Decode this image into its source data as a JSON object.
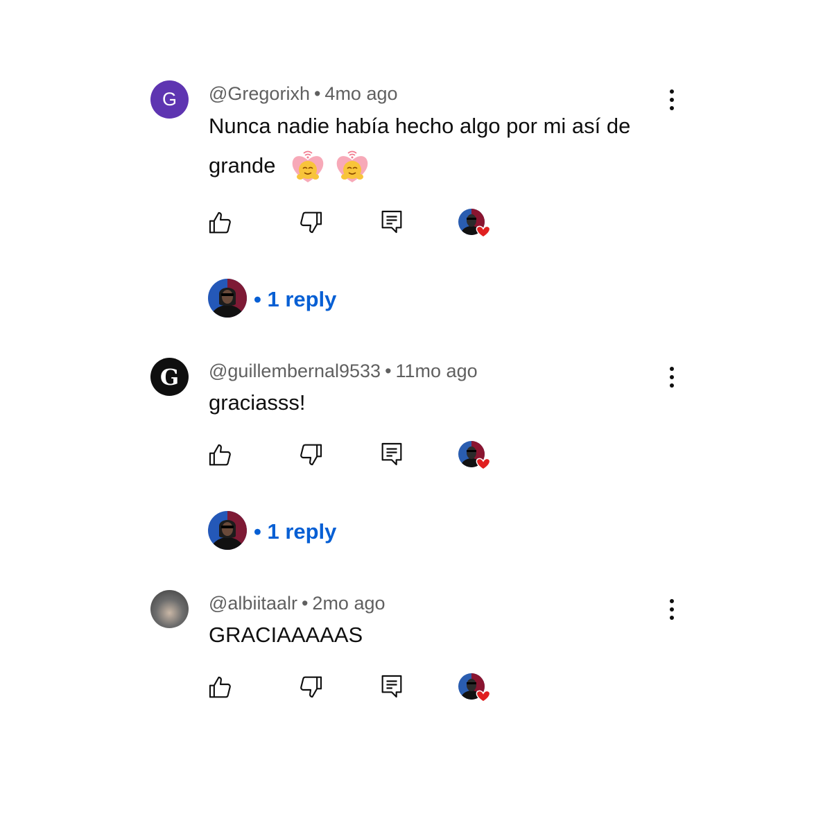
{
  "comments": [
    {
      "author": "@Gregorixh",
      "separator": "•",
      "time": "4mo ago",
      "text": "Nunca nadie había hecho algo por mi así de grande",
      "avatar_letter": "G",
      "avatar_color": "#5e35b1",
      "emojis": [
        "hugging-heart-emoji",
        "hugging-heart-emoji"
      ],
      "reply_label": "• 1 reply"
    },
    {
      "author": "@guillembernal9533",
      "separator": "•",
      "time": "11mo ago",
      "text": "graciasss!",
      "avatar_letter": "G",
      "avatar_color": "#0f0f0f",
      "reply_label": "• 1 reply"
    },
    {
      "author": "@albiitaalr",
      "separator": "•",
      "time": "2mo ago",
      "text": "GRACIAAAAAS",
      "avatar_color": "#8a8a8a"
    }
  ],
  "icons": {
    "like": "thumbs-up-icon",
    "dislike": "thumbs-down-icon",
    "reply": "comment-icon",
    "creator_heart": "creator-heart-icon",
    "more": "more-vert-icon"
  },
  "colors": {
    "reply_link": "#065fd4",
    "meta_text": "#606060",
    "heart": "#e02020"
  }
}
